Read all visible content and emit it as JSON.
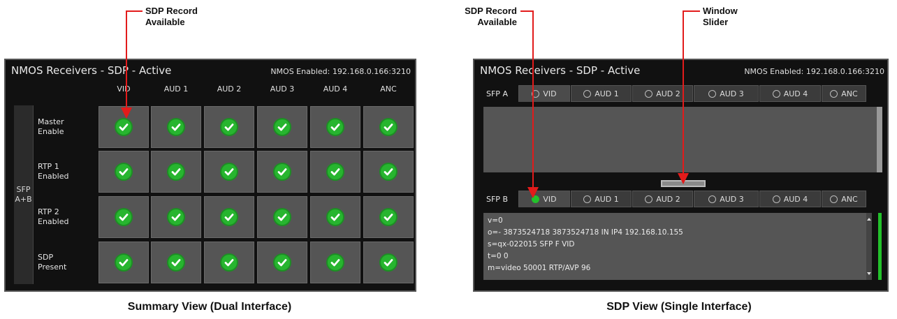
{
  "callouts": {
    "left_sdp": [
      "SDP Record",
      "Available"
    ],
    "right_sdp": [
      "SDP  Record",
      "Available"
    ],
    "window_slider": [
      "Window",
      "Slider"
    ]
  },
  "captions": {
    "left": "Summary View (Dual Interface)",
    "right": "SDP View (Single Interface)"
  },
  "summary": {
    "title": "NMOS Receivers - SDP - Active",
    "status": "NMOS Enabled: 192.168.0.166:3210",
    "columns": [
      "VID",
      "AUD 1",
      "AUD 2",
      "AUD 3",
      "AUD 4",
      "ANC"
    ],
    "side_label": [
      "SFP",
      "A+B"
    ],
    "rows": [
      {
        "label": [
          "Master",
          "Enable"
        ],
        "cells": [
          true,
          true,
          true,
          true,
          true,
          true
        ]
      },
      {
        "label": [
          "RTP 1",
          "Enabled"
        ],
        "cells": [
          true,
          true,
          true,
          true,
          true,
          true
        ]
      },
      {
        "label": [
          "RTP 2",
          "Enabled"
        ],
        "cells": [
          true,
          true,
          true,
          true,
          true,
          true
        ]
      },
      {
        "label": [
          "SDP",
          "Present"
        ],
        "cells": [
          true,
          true,
          true,
          true,
          true,
          true
        ]
      }
    ],
    "colors": {
      "check": "#27b52f",
      "cell": "#555555"
    }
  },
  "sdp_view": {
    "title": "NMOS Receivers - SDP - Active",
    "status": "NMOS Enabled: 192.168.0.166:3210",
    "sfp_a": {
      "label": "SFP A",
      "tabs": [
        {
          "label": "VID",
          "selected": false,
          "active": true
        },
        {
          "label": "AUD 1",
          "selected": false
        },
        {
          "label": "AUD 2",
          "selected": false
        },
        {
          "label": "AUD 3",
          "selected": false
        },
        {
          "label": "AUD 4",
          "selected": false
        },
        {
          "label": "ANC",
          "selected": false
        }
      ]
    },
    "sfp_b": {
      "label": "SFP B",
      "tabs": [
        {
          "label": "VID",
          "selected": true,
          "active": true
        },
        {
          "label": "AUD 1",
          "selected": false
        },
        {
          "label": "AUD 2",
          "selected": false
        },
        {
          "label": "AUD 3",
          "selected": false
        },
        {
          "label": "AUD 4",
          "selected": false
        },
        {
          "label": "ANC",
          "selected": false
        }
      ],
      "sdp_lines": [
        "v=0",
        "o=- 3873524718 3873524718 IN IP4 192.168.10.155",
        "s=qx-022015 SFP F VID",
        "t=0 0",
        "m=video 50001 RTP/AVP 96"
      ]
    },
    "colors": {
      "selected_radio": "#23c12b"
    }
  }
}
